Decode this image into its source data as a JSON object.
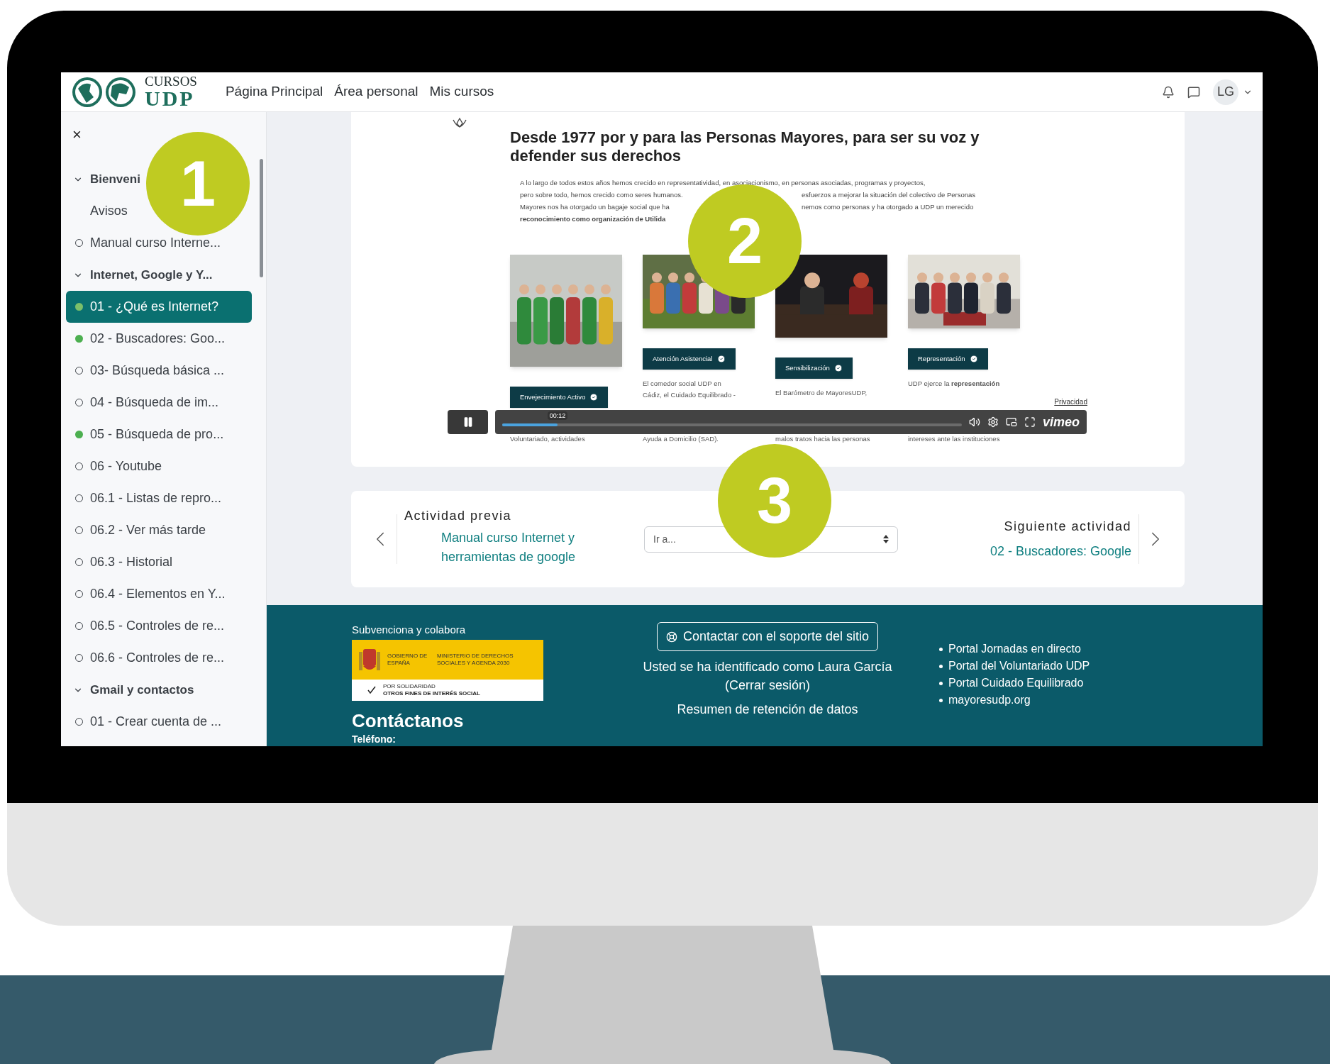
{
  "header": {
    "logo_top": "CURSOS",
    "logo_bottom": "UDP",
    "nav": [
      "Página Principal",
      "Área personal",
      "Mis cursos"
    ],
    "avatar": "LG"
  },
  "sidebar": {
    "close": "×",
    "sections": [
      {
        "label": "Bienveni",
        "expanded": true,
        "children": [
          {
            "kind": "page",
            "label": "Avisos",
            "selected": false
          },
          {
            "kind": "activity",
            "label": "Manual curso Interne...",
            "completed": false,
            "selected": false
          }
        ]
      },
      {
        "label": "Internet, Google y Y...",
        "expanded": true,
        "children": [
          {
            "kind": "activity",
            "label": "01 - ¿Qué es Internet?",
            "completed": true,
            "selected": true
          },
          {
            "kind": "activity",
            "label": "02 - Buscadores: Goo...",
            "completed": true,
            "selected": false
          },
          {
            "kind": "activity",
            "label": "03- Búsqueda básica ...",
            "completed": false,
            "selected": false
          },
          {
            "kind": "activity",
            "label": "04 - Búsqueda de im...",
            "completed": false,
            "selected": false
          },
          {
            "kind": "activity",
            "label": "05 - Búsqueda de pro...",
            "completed": true,
            "selected": false
          },
          {
            "kind": "activity",
            "label": "06 - Youtube",
            "completed": false,
            "selected": false
          },
          {
            "kind": "activity",
            "label": "06.1 - Listas de repro...",
            "completed": false,
            "selected": false
          },
          {
            "kind": "activity",
            "label": "06.2 - Ver más tarde",
            "completed": false,
            "selected": false
          },
          {
            "kind": "activity",
            "label": "06.3 - Historial",
            "completed": false,
            "selected": false
          },
          {
            "kind": "activity",
            "label": "06.4 - Elementos en Y...",
            "completed": false,
            "selected": false
          },
          {
            "kind": "activity",
            "label": "06.5 - Controles de re...",
            "completed": false,
            "selected": false
          },
          {
            "kind": "activity",
            "label": "06.6 - Controles de re...",
            "completed": false,
            "selected": false
          }
        ]
      },
      {
        "label": "Gmail y contactos",
        "expanded": true,
        "children": [
          {
            "kind": "activity",
            "label": "01 - Crear cuenta de ...",
            "completed": false,
            "selected": false
          }
        ]
      }
    ]
  },
  "video": {
    "headline": "Desde 1977 por y para las Personas Mayores, para ser su voz y defender sus derechos",
    "paragraph": [
      {
        "segments": [
          "A lo largo de todos estos años hemos crecido en representatividad, en asociacionismo, en personas asociadas, programas y proyectos,"
        ]
      },
      {
        "segments": [
          "pero sobre todo, hemos crecido como seres humanos.",
          "esfuerzos a mejorar la situación del colectivo de Personas"
        ]
      },
      {
        "segments": [
          "Mayores nos ha otorgado un bagaje social que ha",
          "nemos como personas y ha otorgado a UDP un merecido"
        ]
      },
      {
        "segments": [
          "**reconocimiento como organización de Utilida**"
        ]
      }
    ],
    "columns": [
      {
        "label": "Envejecimiento Activo",
        "lines_below": [
          "Voluntariado, actividades"
        ]
      },
      {
        "label": "Atención Asistencial",
        "lines_above": [
          "El comedor social UDP en",
          "Cádiz, el Cuidado Equilibrado -"
        ],
        "lines_below": [
          "Ayuda a Domicilio (SAD)."
        ]
      },
      {
        "label": "Sensibilización",
        "lines_above": [
          "El Barómetro de MayoresUDP,"
        ],
        "lines_below": [
          "malos tratos hacia las personas"
        ]
      },
      {
        "label": "Representación",
        "lines_above": [
          "UDP ejerce la **representación**"
        ],
        "lines_below": [
          "intereses ante las instituciones"
        ]
      }
    ],
    "privacy": "Privacidad",
    "player": {
      "playing": true,
      "level": 0.12,
      "time": "00:12",
      "brand": "vimeo"
    }
  },
  "navigation": {
    "previous_label": "Actividad previa",
    "previous_link": "Manual curso Internet y herramientas de google",
    "jump_placeholder": "Ir a...",
    "next_label": "Siguiente actividad",
    "next_link": "02 - Buscadores: Google"
  },
  "footer": {
    "sponsor_title": "Subvenciona y colabora",
    "sponsor_logo": {
      "gov": "GOBIERNO DE ESPAÑA",
      "ministry": "MINISTERIO DE DERECHOS SOCIALES Y AGENDA 2030",
      "line1": "POR SOLIDARIDAD",
      "line2": "OTROS FINES DE INTERÉS SOCIAL"
    },
    "contact_title": "Contáctanos",
    "phone_label": "Teléfono:",
    "support_button": "Contactar con el soporte del sitio",
    "logged_in": "Usted se ha identificado como Laura García",
    "logout": "(Cerrar sesión)",
    "data_retention": "Resumen de retención de datos",
    "links": [
      "Portal Jornadas en directo",
      "Portal del Voluntariado UDP",
      "Portal Cuidado Equilibrado",
      "mayoresudp.org"
    ]
  },
  "badges": [
    {
      "label": "1"
    },
    {
      "label": "2"
    },
    {
      "label": "3"
    }
  ]
}
